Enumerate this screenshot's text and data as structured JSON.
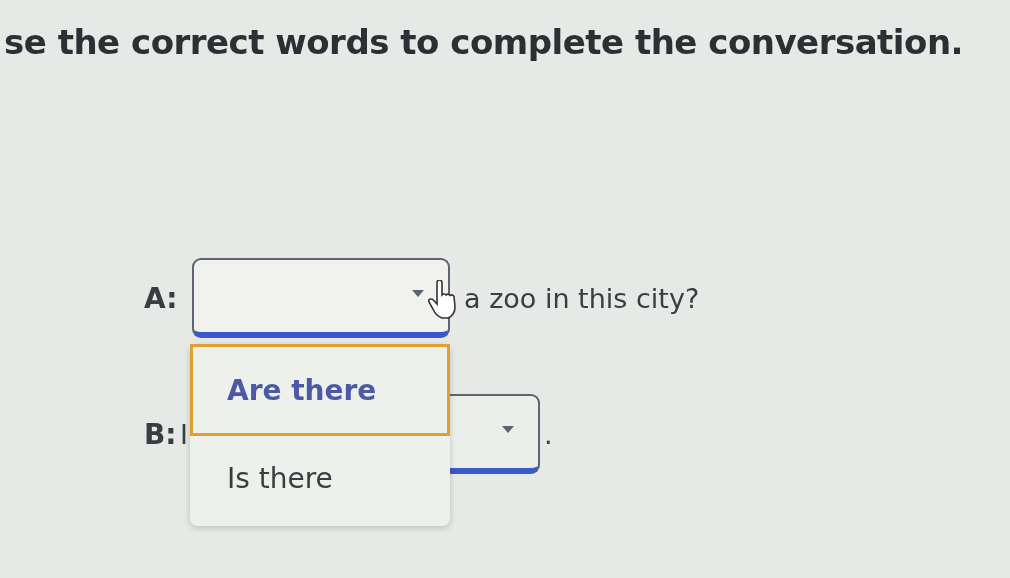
{
  "instruction": "se the correct words to complete the conversation.",
  "lines": [
    {
      "speaker": "A:",
      "dropdown": {
        "expanded": true
      },
      "after": "a zoo in this city?"
    },
    {
      "speaker": "B:",
      "before": "I",
      "dropdown": {
        "expanded": false
      },
      "after": "."
    }
  ],
  "menu_options": [
    {
      "label": "Are there",
      "selected": true
    },
    {
      "label": "Is there",
      "selected": false
    }
  ]
}
